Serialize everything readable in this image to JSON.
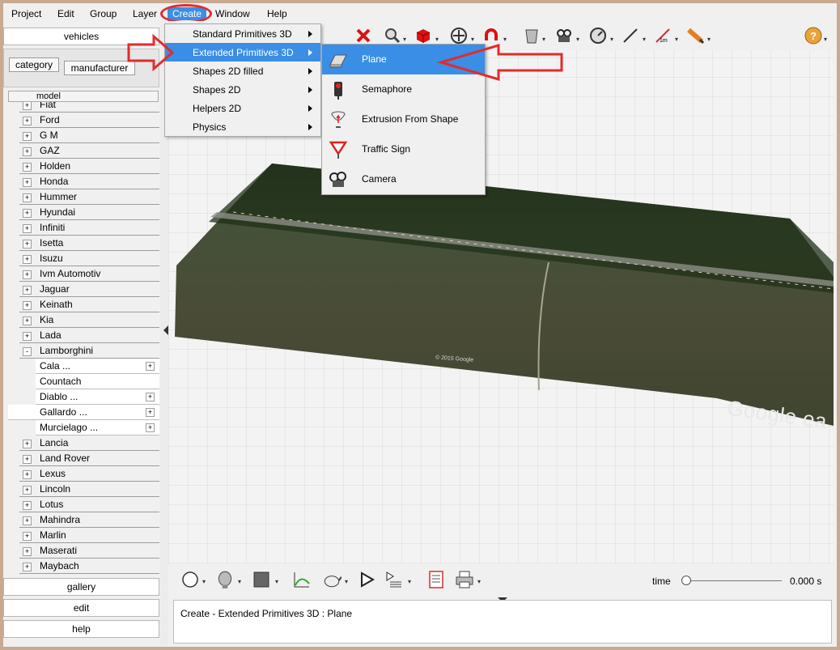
{
  "menubar": {
    "items": [
      "Project",
      "Edit",
      "Group",
      "Layer",
      "Create",
      "Window",
      "Help"
    ]
  },
  "create_menu": {
    "items": [
      {
        "label": "Standard Primitives 3D",
        "has_submenu": true
      },
      {
        "label": "Extended Primitives 3D",
        "has_submenu": true,
        "highlighted": true
      },
      {
        "label": "Shapes 2D filled",
        "has_submenu": true
      },
      {
        "label": "Shapes 2D",
        "has_submenu": true
      },
      {
        "label": "Helpers 2D",
        "has_submenu": true
      },
      {
        "label": "Physics",
        "has_submenu": true
      }
    ]
  },
  "extended_submenu": {
    "items": [
      {
        "label": "Plane",
        "icon": "plane-icon",
        "highlighted": true
      },
      {
        "label": "Semaphore",
        "icon": "semaphore-icon"
      },
      {
        "label": "Extrusion From Shape",
        "icon": "extrusion-icon"
      },
      {
        "label": "Traffic Sign",
        "icon": "traffic-sign-icon"
      },
      {
        "label": "Camera",
        "icon": "camera-icon"
      }
    ]
  },
  "left_panel": {
    "vehicles_label": "vehicles",
    "category_label": "category",
    "manufacturer_label": "manufacturer",
    "model_label": "model",
    "tree": [
      {
        "label": "Fiat",
        "type": "brand",
        "toggle": "+"
      },
      {
        "label": "Ford",
        "type": "brand",
        "toggle": "+"
      },
      {
        "label": "G M",
        "type": "brand",
        "toggle": "+"
      },
      {
        "label": "GAZ",
        "type": "brand",
        "toggle": "+"
      },
      {
        "label": "Holden",
        "type": "brand",
        "toggle": "+"
      },
      {
        "label": "Honda",
        "type": "brand",
        "toggle": "+"
      },
      {
        "label": "Hummer",
        "type": "brand",
        "toggle": "+"
      },
      {
        "label": "Hyundai",
        "type": "brand",
        "toggle": "+"
      },
      {
        "label": "Infiniti",
        "type": "brand",
        "toggle": "+"
      },
      {
        "label": "Isetta",
        "type": "brand",
        "toggle": "+"
      },
      {
        "label": "Isuzu",
        "type": "brand",
        "toggle": "+"
      },
      {
        "label": "Ivm Automotiv",
        "type": "brand",
        "toggle": "+"
      },
      {
        "label": "Jaguar",
        "type": "brand",
        "toggle": "+"
      },
      {
        "label": "Keinath",
        "type": "brand",
        "toggle": "+"
      },
      {
        "label": "Kia",
        "type": "brand",
        "toggle": "+"
      },
      {
        "label": "Lada",
        "type": "brand",
        "toggle": "+"
      },
      {
        "label": "Lamborghini",
        "type": "brand",
        "toggle": "-"
      },
      {
        "label": "Cala ...",
        "type": "model",
        "toggle": "+"
      },
      {
        "label": "Countach",
        "type": "model",
        "toggle": ""
      },
      {
        "label": "Diablo ...",
        "type": "model",
        "toggle": "+"
      },
      {
        "label": "Gallardo ...",
        "type": "model",
        "toggle": "+",
        "highlighted": true
      },
      {
        "label": "Murcielago ...",
        "type": "model",
        "toggle": "+"
      },
      {
        "label": "Lancia",
        "type": "brand",
        "toggle": "+"
      },
      {
        "label": "Land Rover",
        "type": "brand",
        "toggle": "+"
      },
      {
        "label": "Lexus",
        "type": "brand",
        "toggle": "+"
      },
      {
        "label": "Lincoln",
        "type": "brand",
        "toggle": "+"
      },
      {
        "label": "Lotus",
        "type": "brand",
        "toggle": "+"
      },
      {
        "label": "Mahindra",
        "type": "brand",
        "toggle": "+"
      },
      {
        "label": "Marlin",
        "type": "brand",
        "toggle": "+"
      },
      {
        "label": "Maserati",
        "type": "brand",
        "toggle": "+"
      },
      {
        "label": "Maybach",
        "type": "brand",
        "toggle": "+"
      }
    ],
    "gallery_label": "gallery",
    "edit_label": "edit",
    "help_label": "help"
  },
  "viewport": {
    "watermark": "Google ea",
    "copyright": "© 2015 Google"
  },
  "timeline": {
    "time_label": "time",
    "time_value": "0.000 s",
    "position": 0
  },
  "status": {
    "text": "Create - Extended Primitives 3D : Plane"
  },
  "colors": {
    "highlight": "#3a8ee6",
    "annotation_red": "#e32b2b"
  }
}
